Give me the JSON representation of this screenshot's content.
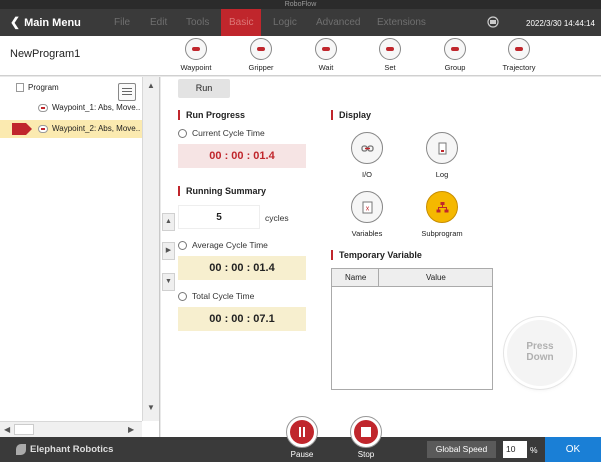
{
  "window": {
    "title": "RoboFlow"
  },
  "menubar": {
    "back_label": "Main Menu",
    "items": [
      "File",
      "Edit",
      "Tools",
      "Basic",
      "Logic",
      "Advanced",
      "Extensions"
    ],
    "active_item": "Basic",
    "datetime": "2022/3/30 14:44:14"
  },
  "toolbar": {
    "program_name": "NewProgram1",
    "tools": [
      {
        "label": "Waypoint",
        "icon": "waypoint-icon"
      },
      {
        "label": "Gripper",
        "icon": "gripper-icon"
      },
      {
        "label": "Wait",
        "icon": "wait-icon"
      },
      {
        "label": "Set",
        "icon": "set-icon"
      },
      {
        "label": "Group",
        "icon": "group-icon"
      },
      {
        "label": "Trajectory",
        "icon": "trajectory-icon"
      }
    ]
  },
  "tree": {
    "root": "Program",
    "items": [
      {
        "label": "Waypoint_1: Abs, Move..",
        "selected": false
      },
      {
        "label": "Waypoint_2: Abs, Move..",
        "selected": true
      }
    ]
  },
  "main": {
    "run_label": "Run",
    "run_progress": {
      "title": "Run Progress",
      "current_label": "Current Cycle Time",
      "current_value": "00 : 00 : 01.4"
    },
    "running_summary": {
      "title": "Running Summary",
      "cycles_value": "5",
      "cycles_unit": "cycles",
      "average_label": "Average Cycle Time",
      "average_value": "00 : 00 : 01.4",
      "total_label": "Total Cycle Time",
      "total_value": "00 : 00 : 07.1"
    },
    "display": {
      "title": "Display",
      "items": [
        {
          "label": "I/O",
          "icon": "io-icon"
        },
        {
          "label": "Log",
          "icon": "log-icon"
        },
        {
          "label": "Variables",
          "icon": "variables-icon"
        },
        {
          "label": "Subprogram",
          "icon": "subprogram-icon"
        }
      ]
    },
    "temporary_variable": {
      "title": "Temporary Variable",
      "columns": [
        "Name",
        "Value"
      ],
      "rows": []
    },
    "press_down_label_1": "Press",
    "press_down_label_2": "Down"
  },
  "bottombar": {
    "brand": "Elephant Robotics",
    "pause_label": "Pause",
    "stop_label": "Stop",
    "global_speed_label": "Global Speed",
    "speed_value": "10",
    "speed_unit": "%",
    "ok_label": "OK"
  },
  "colors": {
    "accent": "#c0262c",
    "ok": "#1a7fd6",
    "highlight": "#fbeab0"
  }
}
